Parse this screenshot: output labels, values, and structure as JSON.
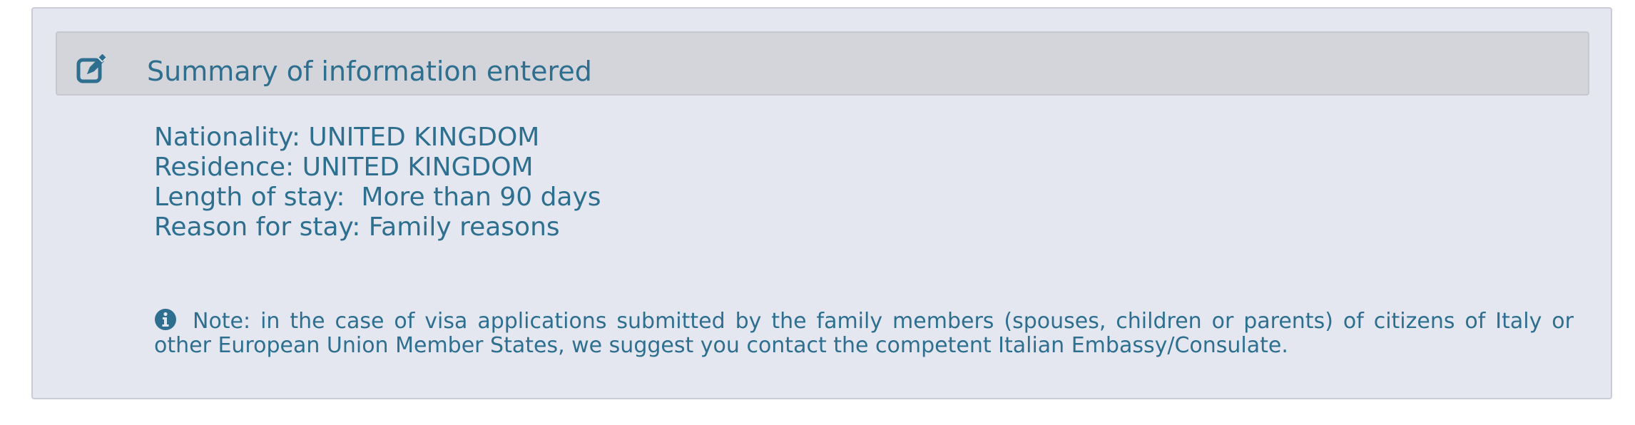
{
  "panel": {
    "title": "Summary of information entered",
    "icon": "edit-icon"
  },
  "summary": {
    "items": [
      "Nationality: UNITED KINGDOM",
      "Residence: UNITED KINGDOM",
      "Length of stay:  More than 90 days",
      "Reason for stay: Family reasons"
    ]
  },
  "note": {
    "icon": "info-icon",
    "text": "Note: in the case of visa applications submitted by the family members (spouses, children or parents) of citizens of Italy or other European Union Member States, we suggest you contact the competent Italian Embassy/Consulate."
  },
  "colors": {
    "text": "#2e6f8f",
    "panel_bg": "#e4e7ef",
    "header_bg": "#d3d5da"
  }
}
